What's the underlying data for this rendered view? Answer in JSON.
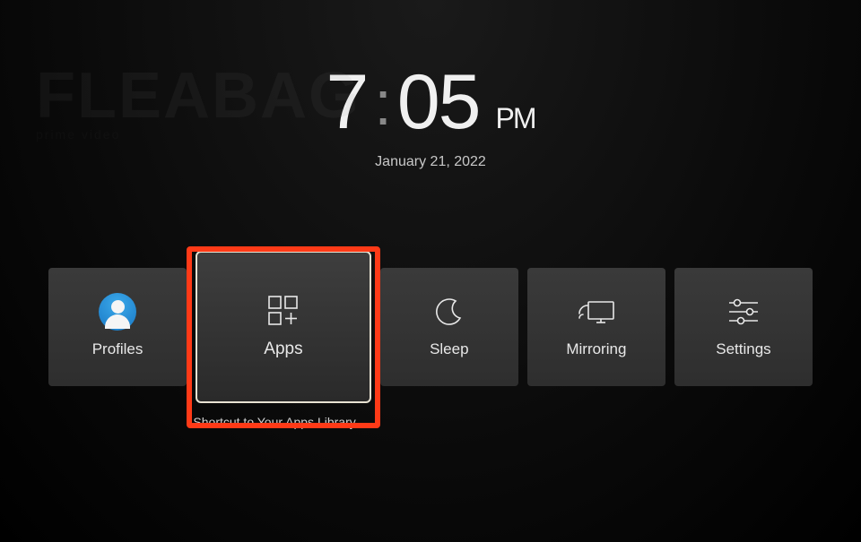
{
  "background": {
    "title": "FLEABAG",
    "provider": "prime video"
  },
  "clock": {
    "hours": "7",
    "minutes": "05",
    "ampm": "PM",
    "date": "January 21, 2022"
  },
  "tiles": [
    {
      "id": "profiles",
      "label": "Profiles",
      "icon": "profile-icon",
      "focused": false
    },
    {
      "id": "apps",
      "label": "Apps",
      "icon": "apps-icon",
      "focused": true
    },
    {
      "id": "sleep",
      "label": "Sleep",
      "icon": "moon-icon",
      "focused": false
    },
    {
      "id": "mirroring",
      "label": "Mirroring",
      "icon": "mirroring-icon",
      "focused": false
    },
    {
      "id": "settings",
      "label": "Settings",
      "icon": "sliders-icon",
      "focused": false
    }
  ],
  "hint": "Shortcut to Your Apps Library."
}
